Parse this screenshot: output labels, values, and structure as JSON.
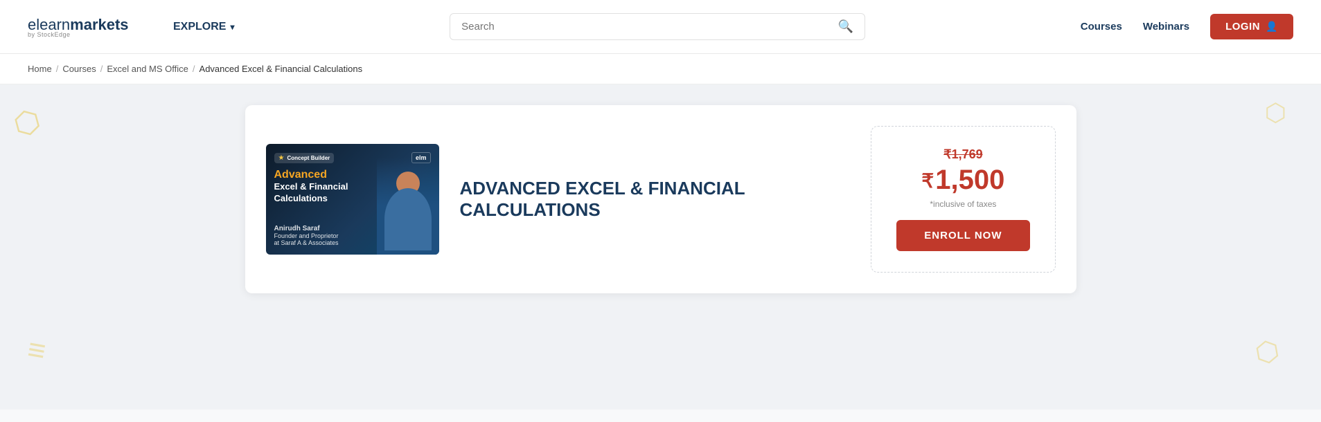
{
  "header": {
    "logo_main": "elearnmarkets",
    "logo_elearn": "elearn",
    "logo_markets": "markets",
    "logo_sub": "by StockEdge",
    "explore_label": "EXPLORE",
    "search_placeholder": "Search",
    "nav_courses": "Courses",
    "nav_webinars": "Webinars",
    "login_label": "LOGIN"
  },
  "breadcrumb": {
    "home": "Home",
    "sep1": "/",
    "courses": "Courses",
    "sep2": "/",
    "category": "Excel and MS Office",
    "sep3": "/",
    "current": "Advanced Excel & Financial Calculations"
  },
  "course": {
    "thumbnail": {
      "badge_concept": "Concept Builder",
      "badge_elm": "elm",
      "title_advanced": "Advanced",
      "title_rest": "Excel & Financial\nCalculations",
      "author_name": "Anirudh Saraf",
      "author_role": "Founder and Proprietor",
      "author_company": "at Saraf A & Associates"
    },
    "title": "ADVANCED EXCEL & FINANCIAL CALCULATIONS",
    "pricing": {
      "original": "₹1,769",
      "discounted": "1,500",
      "rupee": "₹",
      "tax_note": "*inclusive of taxes",
      "enroll_label": "ENROLL NOW"
    }
  },
  "decorative": {
    "tl": "◻",
    "bl": "☰",
    "tr": "◻",
    "br": "◻"
  }
}
